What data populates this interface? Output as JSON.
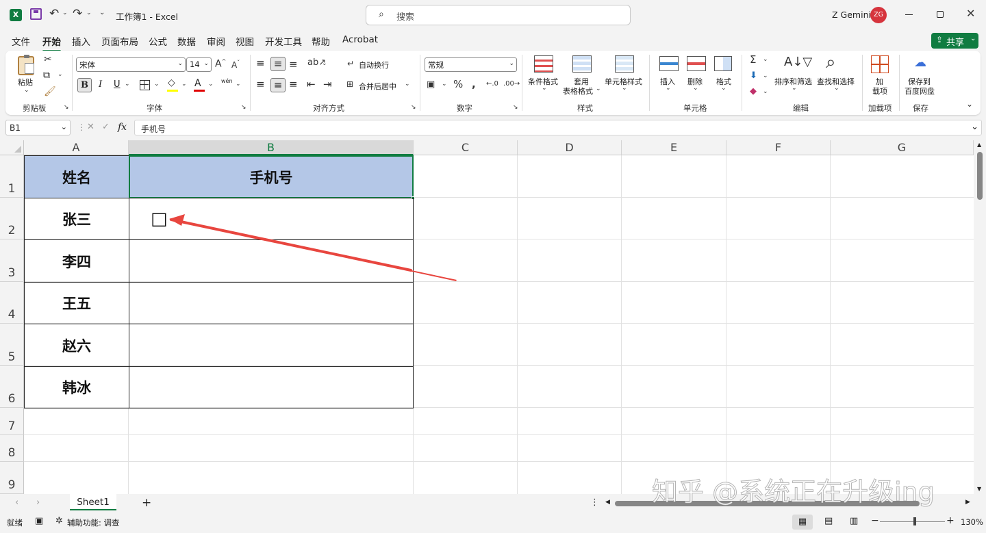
{
  "titlebar": {
    "doc_title": "工作簿1 - Excel",
    "search_placeholder": "搜索",
    "user_name": "Z Gemini",
    "avatar_initials": "ZG",
    "app_icon": "excel-icon"
  },
  "menu": {
    "items": [
      "文件",
      "开始",
      "插入",
      "页面布局",
      "公式",
      "数据",
      "审阅",
      "视图",
      "开发工具",
      "帮助",
      "Acrobat"
    ],
    "active": "开始",
    "share_label": "共享"
  },
  "ribbon": {
    "paste_label": "粘贴",
    "clipboard_group": "剪贴板",
    "font_name": "宋体",
    "font_size": "14",
    "font_group": "字体",
    "bold": "B",
    "italic": "I",
    "underline": "U",
    "wrap_text": "自动换行",
    "merge_center": "合并后居中",
    "align_group": "对齐方式",
    "number_format": "常规",
    "number_group": "数字",
    "cond_format": "条件格式",
    "table_format_1": "套用",
    "table_format_2": "表格格式",
    "cell_styles": "单元格样式",
    "styles_group": "样式",
    "insert": "插入",
    "delete": "删除",
    "format": "格式",
    "cells_group": "单元格",
    "sort_filter": "排序和筛选",
    "find_select": "查找和选择",
    "edit_group": "编辑",
    "addins_1": "加",
    "addins_2": "载项",
    "addins_group": "加载项",
    "save_baidu_1": "保存到",
    "save_baidu_2": "百度网盘",
    "save_group": "保存",
    "wen": "wén"
  },
  "formula": {
    "name_box": "B1",
    "fx": "fx",
    "content": "手机号"
  },
  "grid": {
    "columns": [
      "A",
      "B",
      "C",
      "D",
      "E",
      "F",
      "G"
    ],
    "selected_column": "B",
    "rows": [
      "1",
      "2",
      "3",
      "4",
      "5",
      "6",
      "7",
      "8",
      "9"
    ],
    "table_header": [
      "姓名",
      "手机号"
    ],
    "names": [
      "张三",
      "李四",
      "王五",
      "赵六",
      "韩冰"
    ],
    "checkbox_symbol": "□"
  },
  "sheets": {
    "tabs": [
      "Sheet1"
    ],
    "add": "+"
  },
  "status": {
    "ready": "就绪",
    "accessibility": "辅助功能: 调查",
    "zoom": "130%"
  },
  "watermark": "知乎 @系统正在升级ing",
  "colors": {
    "excel_green": "#107c41",
    "header_fill": "#b4c7e7",
    "arrow_red": "#e8463f",
    "avatar_red": "#d6343d"
  }
}
